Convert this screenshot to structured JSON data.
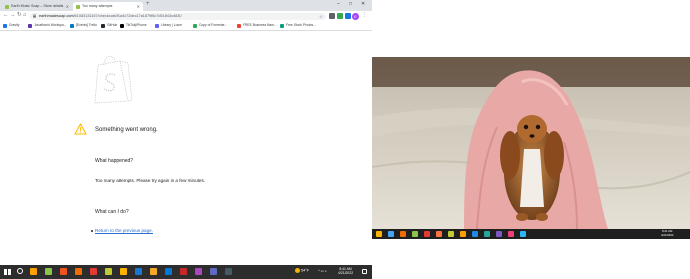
{
  "browser": {
    "tabs": [
      {
        "title": "Earth Music Soap – Store details",
        "favicon_color": "#95bf47"
      },
      {
        "title": "Too many attempts",
        "favicon_color": "#95bf47"
      }
    ],
    "new_tab_symbol": "+",
    "window_controls": {
      "minimize": "–",
      "maximize": "□",
      "close": "✕"
    },
    "nav": {
      "back": "←",
      "forward": "→",
      "reload": "↻",
      "home": "⌂"
    },
    "address": {
      "domain": "earthmadesoap.com",
      "path": "/61083131167/checkouts/f1a4c72dec17a1879f6c7d51843cd830"
    },
    "profile_initial": "E",
    "menu_symbol": "⋮",
    "bookmarks": [
      {
        "label": "Gravity",
        "icon_color": "#1a73e8"
      },
      {
        "label": "Jonathan's Workspa...",
        "icon_color": "#5e35b1"
      },
      {
        "label": "[Events] Trello",
        "icon_color": "#0079bf"
      },
      {
        "label": "GitHub",
        "icon_color": "#24292e"
      },
      {
        "label": "TikTok|iPhone",
        "icon_color": "#000000"
      },
      {
        "label": "Library | Loom",
        "icon_color": "#625df5"
      },
      {
        "label": "Copy of Forrester...",
        "icon_color": "#34a853"
      },
      {
        "label": "FREE Business Nam...",
        "icon_color": "#ea4335"
      },
      {
        "label": "Free Stock Photos...",
        "icon_color": "#05a081"
      }
    ]
  },
  "page": {
    "error_title": "Something went wrong.",
    "section_1_heading": "What happened?",
    "section_1_body": "Too many attempts. Please try again in a few minutes.",
    "section_2_heading": "What can I do?",
    "back_link": "Return to the previous page.",
    "warning_color": "#ffb800",
    "link_color": "#2c6ecb"
  },
  "left_taskbar": {
    "weather": "54°F",
    "clock_time": "8:41 AM",
    "clock_date": "4/21/2022",
    "pinned_icon_colors": [
      "#ffa000",
      "#8bc34a",
      "#f4511e",
      "#ef6c00",
      "#e53935",
      "#c0ca33",
      "#ffb300",
      "#1976d2",
      "#f9a825",
      "#0078d4",
      "#c62828",
      "#ab47bc",
      "#5c6bc0",
      "#455a64"
    ]
  },
  "right_screen": {
    "clock_time": "8:41 AM",
    "clock_date": "4/21/2022",
    "pinned_icon_colors": [
      "#ffb300",
      "#42a5f5",
      "#ef6c00",
      "#8bc34a",
      "#e53935",
      "#ff7043",
      "#c0ca33",
      "#ffa000",
      "#1e88e5",
      "#26a69a",
      "#7e57c2",
      "#ec407a",
      "#29b6f6"
    ]
  }
}
